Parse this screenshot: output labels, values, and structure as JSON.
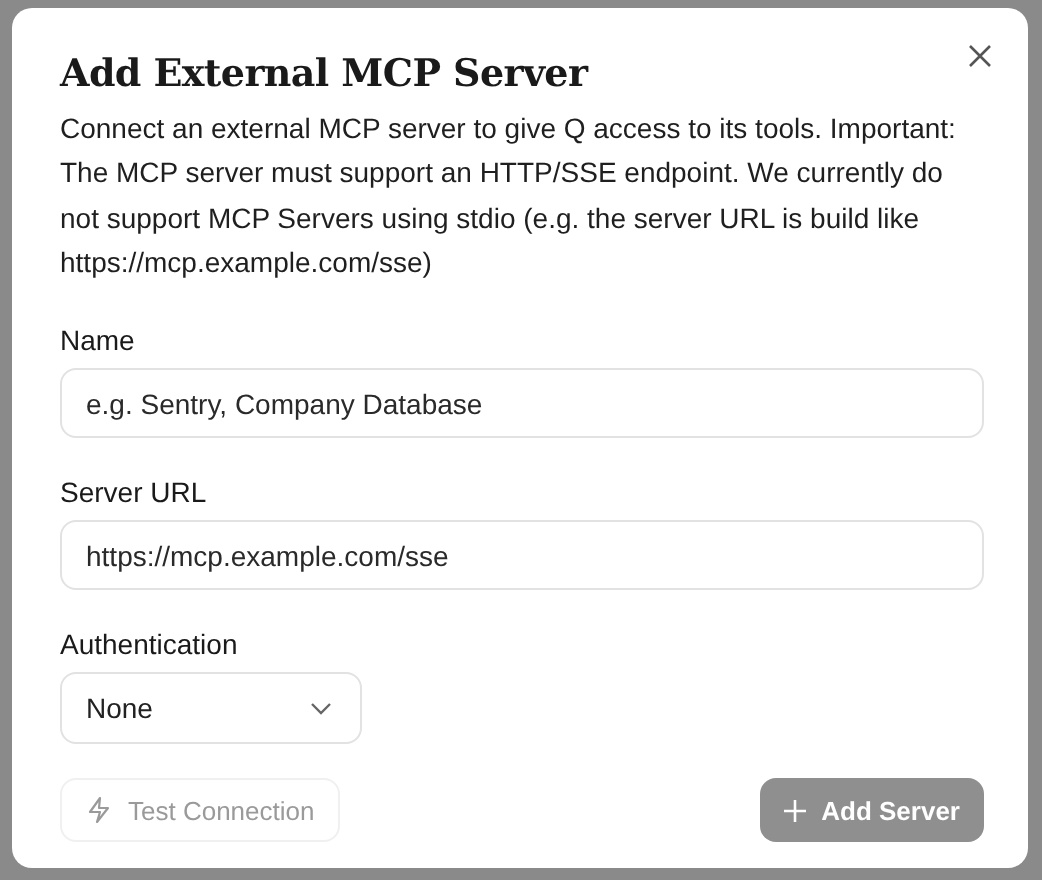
{
  "dialog": {
    "title": "Add External MCP Server",
    "description": "Connect an external MCP server to give Q access to its tools. Important: The MCP server must support an HTTP/SSE endpoint. We currently do not support MCP Servers using stdio (e.g. the server URL is build like https://mcp.example.com/sse)",
    "fields": [
      {
        "kind": "text",
        "label": "Name",
        "placeholder": "e.g. Sentry, Company Database"
      },
      {
        "kind": "text",
        "label": "Server URL",
        "placeholder": "https://mcp.example.com/sse"
      },
      {
        "kind": "select",
        "label": "Authentication",
        "value": "None"
      }
    ],
    "buttons": [
      {
        "kind": "secondary",
        "label": "Test Connection",
        "disabled": true
      },
      {
        "kind": "primary",
        "label": "Add Server",
        "disabled": true
      }
    ]
  }
}
